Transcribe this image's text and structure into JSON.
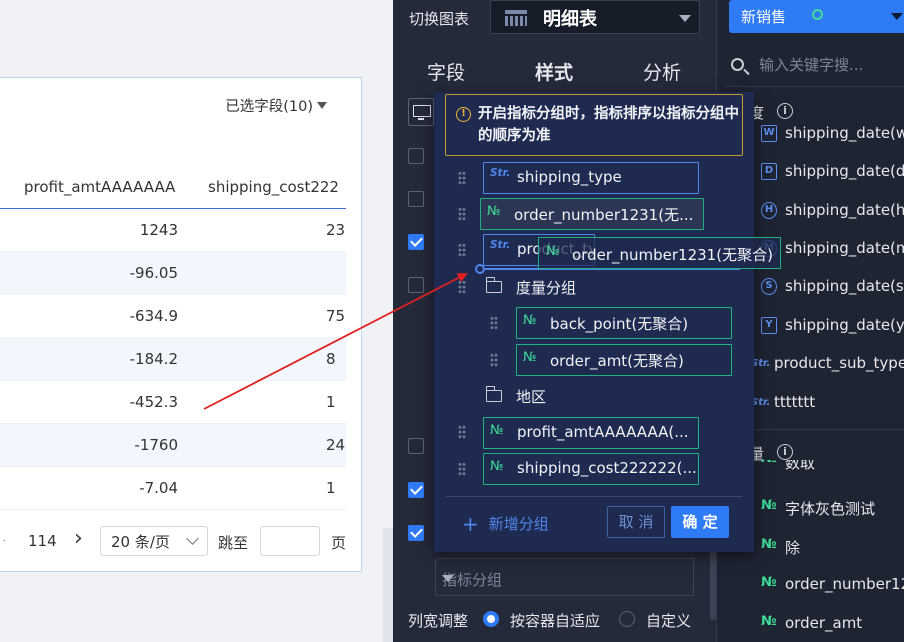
{
  "table": {
    "selected_fields": "已选字段(10)",
    "columns": [
      "profit_amtAAAAAAA",
      "shipping_cost222"
    ],
    "rows": [
      [
        "1243",
        "23"
      ],
      [
        "-96.05",
        ""
      ],
      [
        "-634.9",
        "75"
      ],
      [
        "-184.2",
        "8"
      ],
      [
        "-452.3",
        "1"
      ],
      [
        "-1760",
        "24"
      ],
      [
        "-7.04",
        "1"
      ]
    ],
    "pager": {
      "total_pages": "114",
      "next": "›",
      "page_size": "20 条/页",
      "goto": "跳至",
      "page_unit": "页"
    }
  },
  "config": {
    "switch_chart_label": "切换图表",
    "chart_type": "明细表",
    "tabs": [
      "字段",
      "样式",
      "分析"
    ],
    "metric_group_placeholder": "指标分组",
    "column_width_label": "列宽调整",
    "radio_auto": "按容器自适应",
    "radio_custom": "自定义"
  },
  "fields": {
    "dataset": "新销售",
    "search_placeholder": "输入关键字搜...",
    "dimension_section": "度",
    "items": [
      {
        "icon": "W",
        "label": "shipping_date(we"
      },
      {
        "icon": "D",
        "label": "shipping_date(da"
      },
      {
        "icon": "H",
        "label": "shipping_date(ho"
      },
      {
        "icon": "M",
        "label": "shipping_date(m"
      },
      {
        "icon": "S",
        "label": "shipping_date(se"
      },
      {
        "icon": "Y",
        "label": "shipping_date(yr"
      },
      {
        "icon": "Str.",
        "label": "product_sub_type"
      },
      {
        "icon": "Str.",
        "label": "ttttttt"
      }
    ],
    "measure_section": "量",
    "measure_items": [
      {
        "icon": "№",
        "label": "数取"
      },
      {
        "icon": "№",
        "label": "字体灰色测试"
      },
      {
        "icon": "№",
        "label": "除"
      },
      {
        "icon": "№",
        "label": "order_number12"
      },
      {
        "icon": "№",
        "label": "order_amt"
      }
    ]
  },
  "modal": {
    "alert": "开启指标分组时，指标排序以指标分组中的顺序为准",
    "chips": [
      {
        "type": "Str.",
        "label": "shipping_type"
      },
      {
        "type": "№",
        "label": "order_number1231(无..."
      },
      {
        "type": "Str.",
        "label": "product_type"
      },
      {
        "type": "№",
        "label": "back_point(无聚合)"
      },
      {
        "type": "№",
        "label": "order_amt(无聚合)"
      },
      {
        "type": "№",
        "label": "profit_amtAAAAAAA(..."
      },
      {
        "type": "№",
        "label": "shipping_cost222222(..."
      }
    ],
    "groups": [
      "度量分组",
      "地区"
    ],
    "drag_ghost": "order_number1231(无聚合)",
    "add_group": "新增分组",
    "cancel": "取 消",
    "confirm": "确 定"
  },
  "colors": {
    "accent": "#2f7bf6",
    "numeric_green": "#3ddc97",
    "warning": "#f3b63c",
    "arrow": "#e01f1f"
  }
}
